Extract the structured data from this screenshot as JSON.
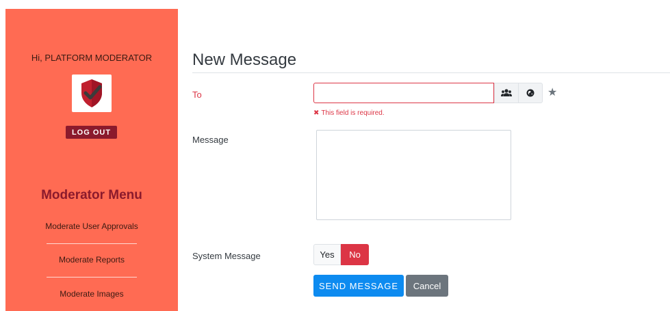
{
  "sidebar": {
    "greeting": "Hi, PLATFORM MODERATOR",
    "logout_label": "LOG OUT",
    "menu_title": "Moderator Menu",
    "menu_items": [
      {
        "label": "Moderate User Approvals"
      },
      {
        "label": "Moderate Reports"
      },
      {
        "label": "Moderate Images"
      }
    ]
  },
  "main": {
    "title": "New Message",
    "to": {
      "label": "To",
      "value": "",
      "error": "This field is required."
    },
    "message": {
      "label": "Message",
      "value": ""
    },
    "system_message": {
      "label": "System Message",
      "yes_label": "Yes",
      "no_label": "No",
      "selected": "No"
    },
    "send_label": "SEND MESSAGE",
    "cancel_label": "Cancel"
  },
  "colors": {
    "sidebar_bg": "#ff6b53",
    "brand_dark": "#8b1a2c",
    "error": "#dc3545",
    "primary": "#0d8bf0",
    "secondary": "#6c757d"
  }
}
